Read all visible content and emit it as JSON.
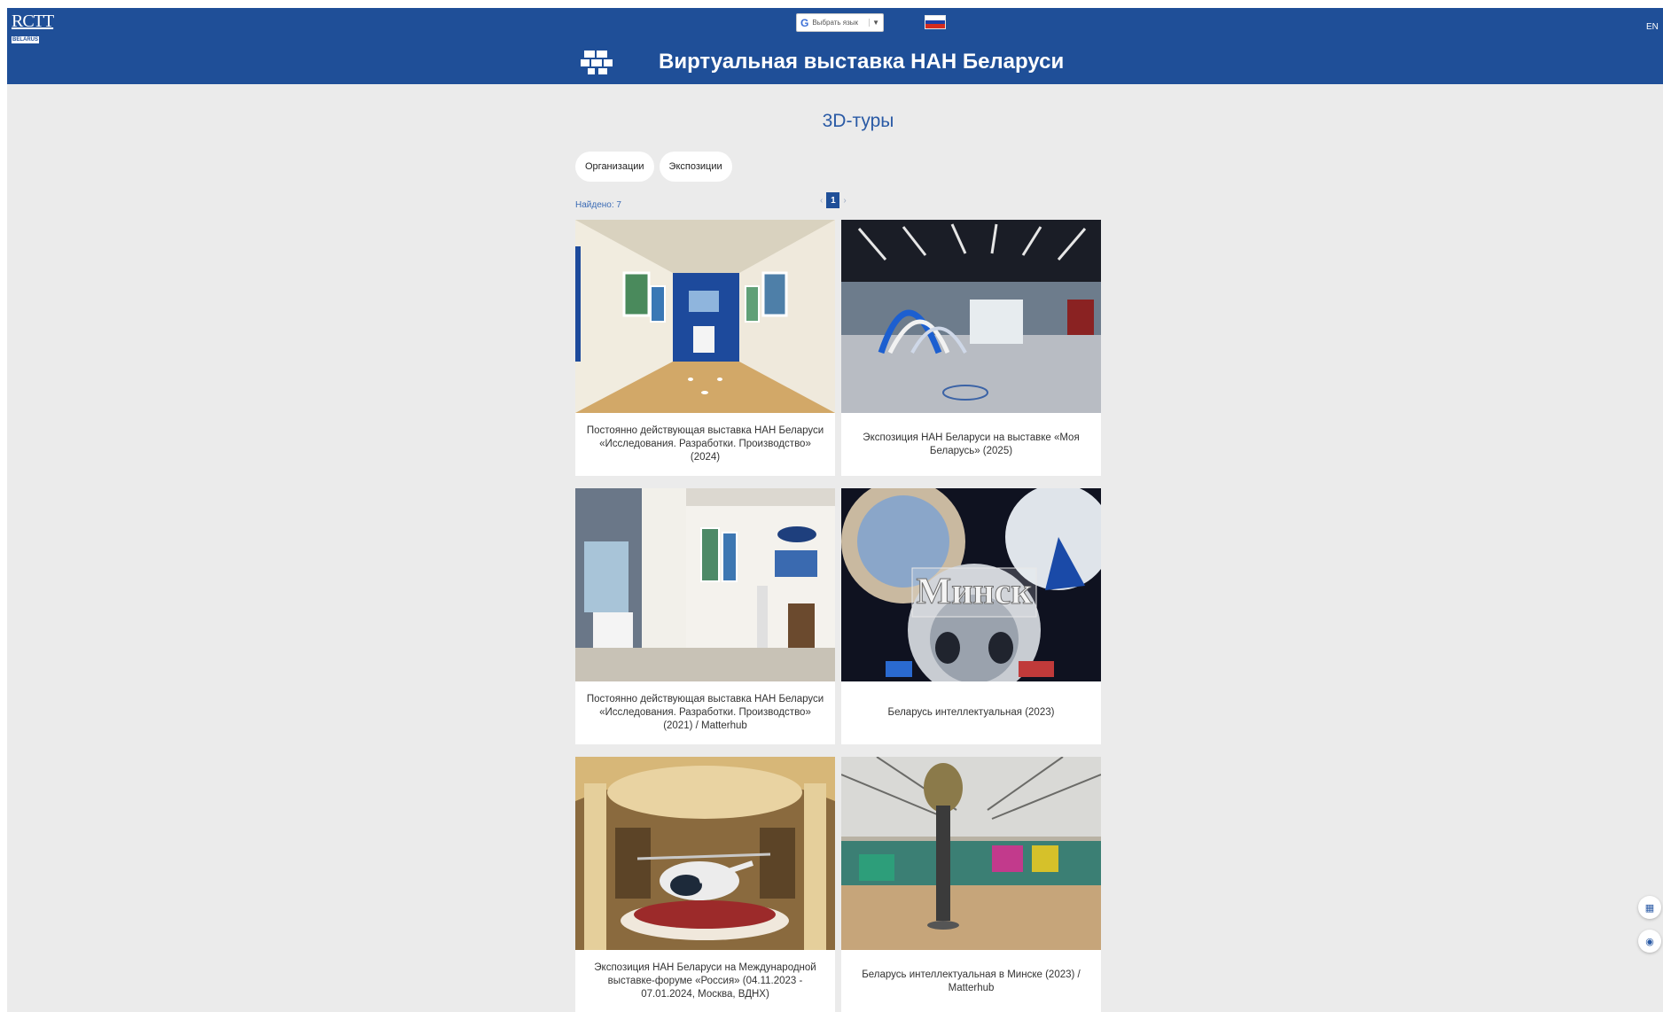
{
  "header": {
    "logo_text": "RCTT",
    "logo_sub": "BELARUS",
    "translate_label": "Выбрать язык",
    "language_switch": "EN",
    "site_title": "Виртуальная выставка НАН Беларуси",
    "bg_color": "#1f4f98"
  },
  "main": {
    "section_title": "3D-туры",
    "filters": [
      "Организации",
      "Экспозиции"
    ],
    "found_text": "Найдено: 7",
    "pagination": {
      "prev": "‹",
      "current": "1",
      "next": "›"
    },
    "cards": [
      {
        "title": "Постоянно действующая выставка НАН Беларуси «Исследования. Разработки. Производство» (2024)",
        "image": "exhibition-hall-corridor"
      },
      {
        "title": "Экспозиция НАН Беларуси на выставке «Моя Беларусь» (2025)",
        "image": "expo-pavilion-arches"
      },
      {
        "title": "Постоянно действующая выставка НАН Беларуси «Исследования. Разработки. Производство» (2021) / Matterhub",
        "image": "exhibition-hall-room"
      },
      {
        "title": "Беларусь интеллектуальная (2023)",
        "image": "minsk-panorama",
        "image_text": "Минск"
      },
      {
        "title": "Экспозиция НАН Беларуси на Международной выставке-форуме «Россия» (04.11.2023 - 07.01.2024, Москва, ВДНХ)",
        "image": "helicopter-hall"
      },
      {
        "title": "Беларусь интеллектуальная в Минске (2023) / Matterhub",
        "image": "expo-hall-column"
      }
    ]
  },
  "side_buttons": [
    "qr-icon",
    "accessibility-icon"
  ]
}
